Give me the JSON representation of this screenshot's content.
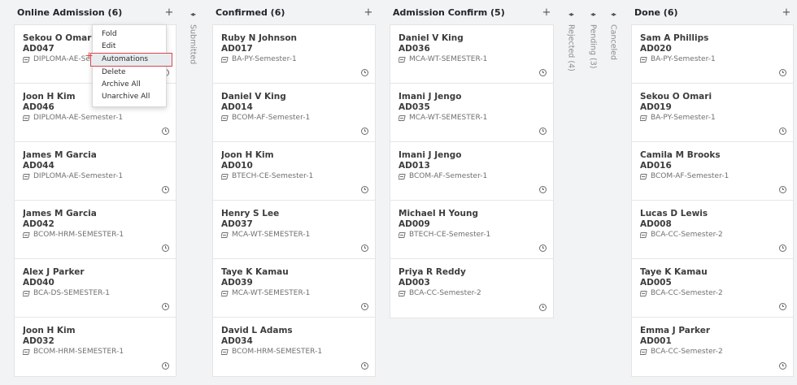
{
  "columns": [
    {
      "title": "Online Admission (6)",
      "plus": "+",
      "cards": [
        {
          "name": "Sekou O Omari",
          "code": "AD047",
          "tag": "DIPLOMA-AE-Semester-1"
        },
        {
          "name": "Joon H Kim",
          "code": "AD046",
          "tag": "DIPLOMA-AE-Semester-1"
        },
        {
          "name": "James M Garcia",
          "code": "AD044",
          "tag": "DIPLOMA-AE-Semester-1"
        },
        {
          "name": "James M Garcia",
          "code": "AD042",
          "tag": "BCOM-HRM-SEMESTER-1"
        },
        {
          "name": "Alex J Parker",
          "code": "AD040",
          "tag": "BCA-DS-SEMESTER-1"
        },
        {
          "name": "Joon H Kim",
          "code": "AD032",
          "tag": "BCOM-HRM-SEMESTER-1"
        }
      ]
    },
    {
      "title": "Confirmed (6)",
      "plus": "+",
      "cards": [
        {
          "name": "Ruby N Johnson",
          "code": "AD017",
          "tag": "BA-PY-Semester-1"
        },
        {
          "name": "Daniel V King",
          "code": "AD014",
          "tag": "BCOM-AF-Semester-1"
        },
        {
          "name": "Joon H Kim",
          "code": "AD010",
          "tag": "BTECH-CE-Semester-1"
        },
        {
          "name": "Henry S Lee",
          "code": "AD037",
          "tag": "MCA-WT-SEMESTER-1"
        },
        {
          "name": "Taye K Kamau",
          "code": "AD039",
          "tag": "MCA-WT-SEMESTER-1"
        },
        {
          "name": "David L Adams",
          "code": "AD034",
          "tag": "BCOM-HRM-SEMESTER-1"
        }
      ]
    },
    {
      "title": "Admission Confirm (5)",
      "plus": "+",
      "cards": [
        {
          "name": "Daniel V King",
          "code": "AD036",
          "tag": "MCA-WT-SEMESTER-1"
        },
        {
          "name": "Imani J Jengo",
          "code": "AD035",
          "tag": "MCA-WT-SEMESTER-1"
        },
        {
          "name": "Imani J Jengo",
          "code": "AD013",
          "tag": "BCOM-AF-Semester-1"
        },
        {
          "name": "Michael H Young",
          "code": "AD009",
          "tag": "BTECH-CE-Semester-1"
        },
        {
          "name": "Priya R Reddy",
          "code": "AD003",
          "tag": "BCA-CC-Semester-2"
        }
      ]
    },
    {
      "title": "Done (6)",
      "plus": "+",
      "cards": [
        {
          "name": "Sam A Phillips",
          "code": "AD020",
          "tag": "BA-PY-Semester-1"
        },
        {
          "name": "Sekou O Omari",
          "code": "AD019",
          "tag": "BA-PY-Semester-1"
        },
        {
          "name": "Camila M Brooks",
          "code": "AD016",
          "tag": "BCOM-AF-Semester-1"
        },
        {
          "name": "Lucas D Lewis",
          "code": "AD008",
          "tag": "BCA-CC-Semester-2"
        },
        {
          "name": "Taye K Kamau",
          "code": "AD005",
          "tag": "BCA-CC-Semester-2"
        },
        {
          "name": "Emma J Parker",
          "code": "AD001",
          "tag": "BCA-CC-Semester-2"
        }
      ]
    }
  ],
  "folded": [
    {
      "label": "Submitted",
      "arrows": "◂▸"
    },
    {
      "label": "Rejected (4)",
      "arrows": "◂▸"
    },
    {
      "label": "Pending (3)",
      "arrows": "◂▸"
    },
    {
      "label": "Canceled",
      "arrows": "◂▸"
    }
  ],
  "menu": {
    "items": [
      "Fold",
      "Edit",
      "Automations",
      "Delete",
      "Archive All",
      "Unarchive All"
    ],
    "active": "Automations"
  },
  "icons": {
    "tag": "tag-icon",
    "clock": "clock-icon",
    "fold": "fold-arrows-icon",
    "add": "plus-icon"
  },
  "colors": {
    "highlight_border": "#d9474f",
    "background": "#f2f3f5"
  }
}
